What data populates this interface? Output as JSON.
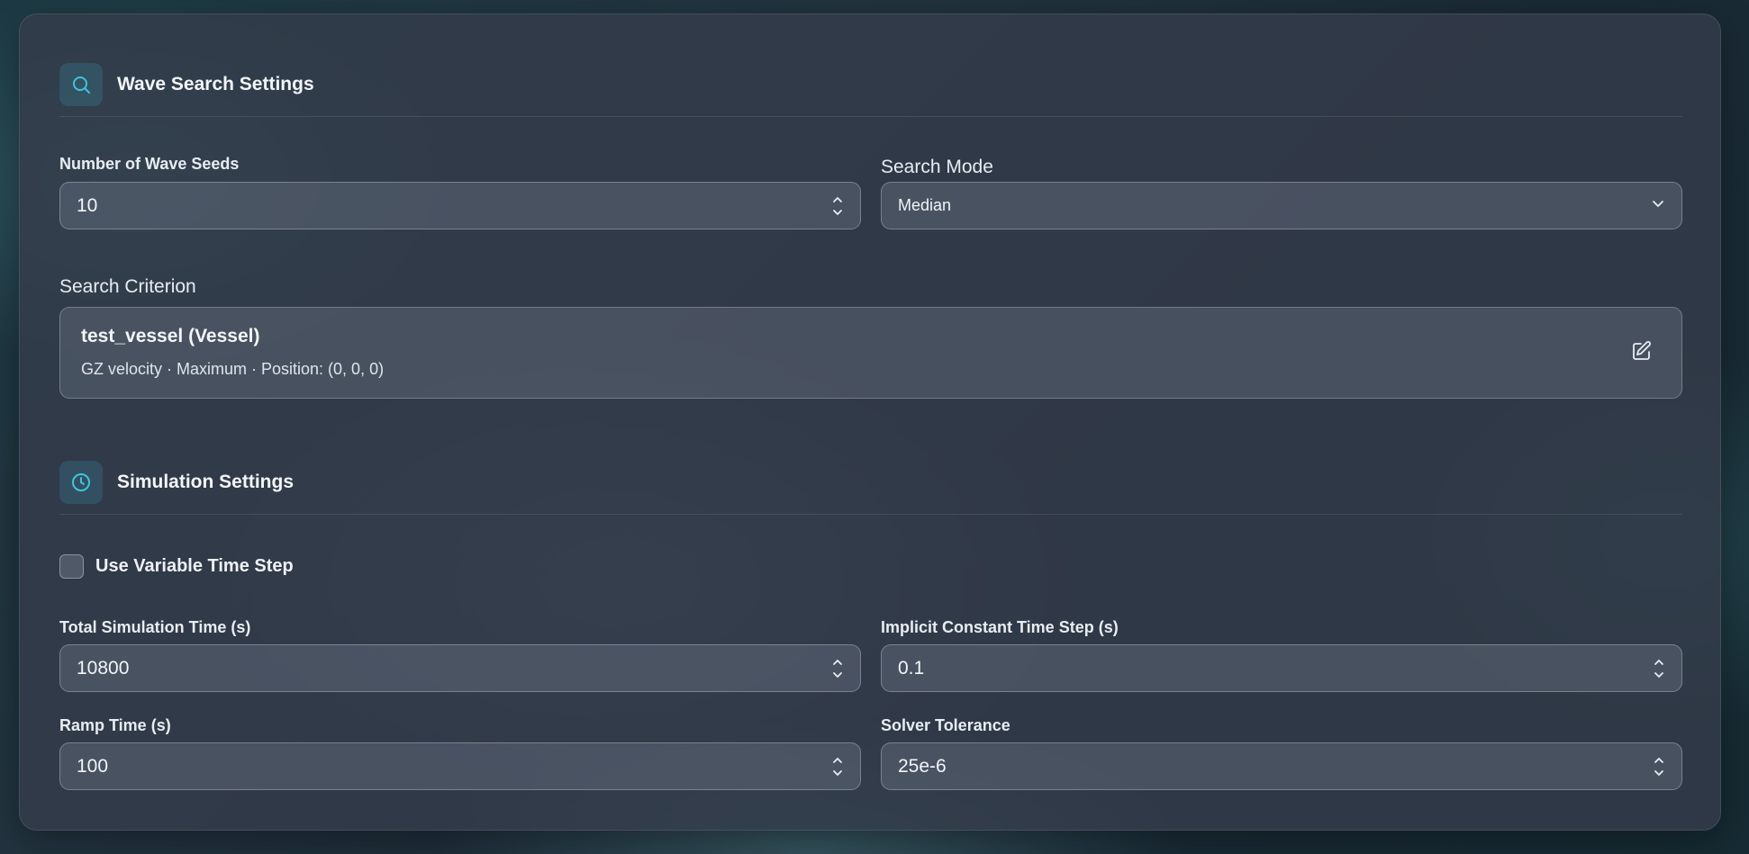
{
  "wave_search": {
    "title": "Wave Search Settings",
    "icon": "search-icon",
    "seeds_label": "Number of Wave Seeds",
    "seeds_value": "10",
    "mode_label": "Search Mode",
    "mode_value": "Median",
    "criterion_label": "Search Criterion",
    "criterion_title": "test_vessel (Vessel)",
    "criterion_detail": "GZ velocity · Maximum · Position: (0, 0, 0)"
  },
  "simulation": {
    "title": "Simulation Settings",
    "icon": "clock-icon",
    "variable_step_label": "Use Variable Time Step",
    "variable_step_checked": false,
    "total_time_label": "Total Simulation Time (s)",
    "total_time_value": "10800",
    "time_step_label": "Implicit Constant Time Step (s)",
    "time_step_value": "0.1",
    "ramp_label": "Ramp Time (s)",
    "ramp_value": "100",
    "tolerance_label": "Solver Tolerance",
    "tolerance_value": "25e-6"
  },
  "colors": {
    "accent": "#3fc4dc",
    "panel": "#343c4a"
  }
}
